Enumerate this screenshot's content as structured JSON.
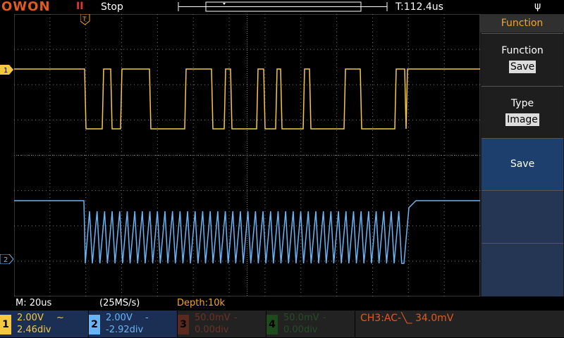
{
  "header": {
    "logo": "OWON",
    "run_indicator": "II",
    "run_status": "Stop",
    "trigger_time": "T:112.4us",
    "usb_icon": "usb-icon",
    "trigger_marker": "T"
  },
  "screen": {
    "ch1_marker": "1",
    "ch2_marker": "2"
  },
  "menu": {
    "title": "Function",
    "items": [
      {
        "label": "Function",
        "value": "Save"
      },
      {
        "label": "Type",
        "value": "Image"
      },
      {
        "label": "Save"
      }
    ]
  },
  "status_line": {
    "timebase": "M: 20us",
    "sample_rate": "(25MS/s)",
    "depth": "Depth:10k"
  },
  "channels": [
    {
      "num": "1",
      "volts": "2.00V",
      "coupling": "~",
      "offset": "2.46div",
      "color": "#f5c842",
      "active": true
    },
    {
      "num": "2",
      "volts": "2.00V",
      "coupling": "-",
      "offset": "-2.92div",
      "color": "#6ab4f5",
      "active": true
    },
    {
      "num": "3",
      "volts": "50.0mV",
      "coupling": "-",
      "offset": "0.00div",
      "color": "#7a3a2a",
      "active": false
    },
    {
      "num": "4",
      "volts": "50.0mV",
      "coupling": "-",
      "offset": "0.00div",
      "color": "#2a5a2a",
      "active": false
    }
  ],
  "trigger_status": "CH3:AC-╲_ 34.0mV",
  "colors": {
    "ch1": "#f5c842",
    "ch2": "#6ab4f5",
    "accent": "#f5a623",
    "menu_selected": "#1d3f6e"
  }
}
